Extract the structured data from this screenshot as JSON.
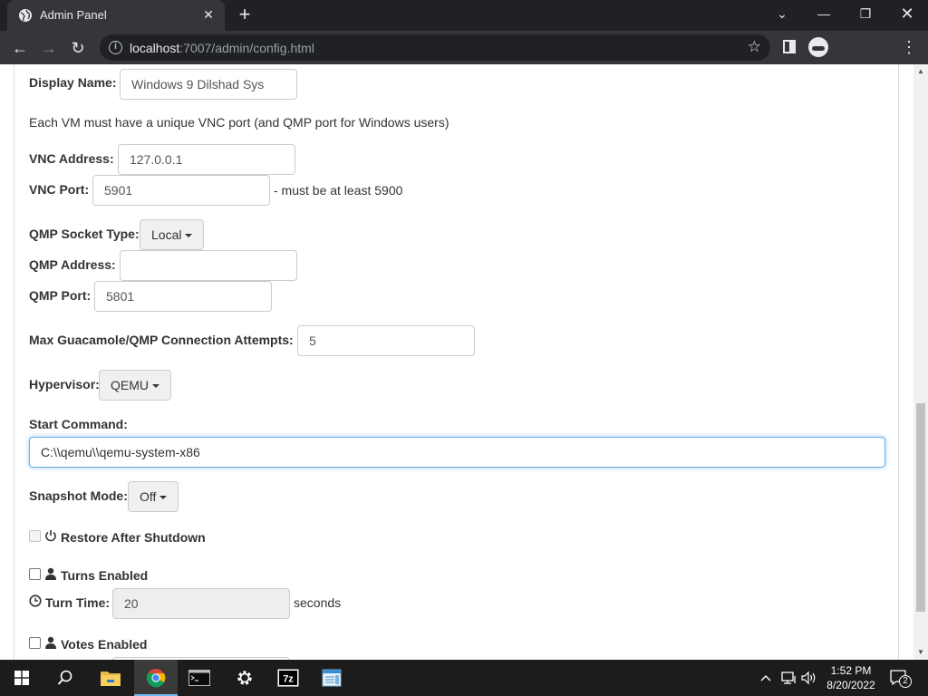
{
  "browser": {
    "tab_title": "Admin Panel",
    "url_host": "localhost",
    "url_rest": ":7007/admin/config.html",
    "incognito_label": "Incognito"
  },
  "form": {
    "display_name_label": "Display Name:",
    "display_name_value": "Windows 9 Dilshad Sys",
    "vnc_note": "Each VM must have a unique VNC port (and QMP port for Windows users)",
    "vnc_address_label": "VNC Address:",
    "vnc_address_value": "127.0.0.1",
    "vnc_port_label": "VNC Port:",
    "vnc_port_value": "5901",
    "vnc_port_hint": "- must be at least 5900",
    "qmp_socket_type_label": "QMP Socket Type:",
    "qmp_socket_type_value": "Local",
    "qmp_address_label": "QMP Address:",
    "qmp_address_value": "",
    "qmp_port_label": "QMP Port:",
    "qmp_port_value": "5801",
    "max_attempts_label": "Max Guacamole/QMP Connection Attempts:",
    "max_attempts_value": "5",
    "hypervisor_label": "Hypervisor:",
    "hypervisor_value": "QEMU",
    "start_command_label": "Start Command:",
    "start_command_value": "C:\\\\qemu\\\\qemu-system-x86",
    "snapshot_mode_label": "Snapshot Mode:",
    "snapshot_mode_value": "Off",
    "restore_label": "Restore After Shutdown",
    "turns_label": "Turns Enabled",
    "turn_time_label": "Turn Time:",
    "turn_time_value": "20",
    "turn_time_unit": "seconds",
    "votes_label": "Votes Enabled"
  },
  "taskbar": {
    "time": "1:52 PM",
    "date": "8/20/2022",
    "notifications": "2"
  }
}
